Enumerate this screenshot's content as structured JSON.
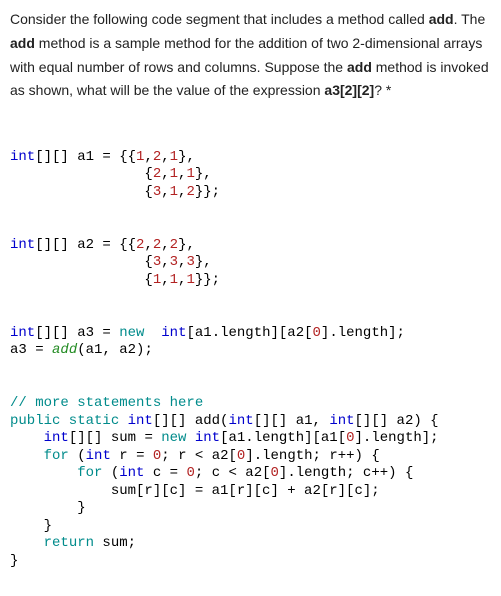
{
  "question": {
    "p1_a": "Consider the following code segment that includes a method called ",
    "add1": "add",
    "p1_b": ". The ",
    "add2": "add",
    "p1_c": " method is a sample method for the addition of two 2-dimensional arrays with equal number of rows and columns. Suppose the ",
    "add3": "add",
    "p1_d": " method is invoked as shown, what will be the value of the expression ",
    "expr": "a3[2][2]",
    "p1_e": "? *"
  },
  "code": {
    "a1_l1_a": "int",
    "a1_l1_b": "[][] a1 = {{",
    "a1_l1_c": "1",
    "a1_l1_d": ",",
    "a1_l1_e": "2",
    "a1_l1_f": ",",
    "a1_l1_g": "1",
    "a1_l1_h": "},",
    "a1_l2_a": "                {",
    "a1_l2_b": "2",
    "a1_l2_c": ",",
    "a1_l2_d": "1",
    "a1_l2_e": ",",
    "a1_l2_f": "1",
    "a1_l2_g": "},",
    "a1_l3_a": "                {",
    "a1_l3_b": "3",
    "a1_l3_c": ",",
    "a1_l3_d": "1",
    "a1_l3_e": ",",
    "a1_l3_f": "2",
    "a1_l3_g": "}};",
    "a2_l1_a": "int",
    "a2_l1_b": "[][] a2 = {{",
    "a2_l1_c": "2",
    "a2_l1_d": ",",
    "a2_l1_e": "2",
    "a2_l1_f": ",",
    "a2_l1_g": "2",
    "a2_l1_h": "},",
    "a2_l2_a": "                {",
    "a2_l2_b": "3",
    "a2_l2_c": ",",
    "a2_l2_d": "3",
    "a2_l2_e": ",",
    "a2_l2_f": "3",
    "a2_l2_g": "},",
    "a2_l3_a": "                {",
    "a2_l3_b": "1",
    "a2_l3_c": ",",
    "a2_l3_d": "1",
    "a2_l3_e": ",",
    "a2_l3_f": "1",
    "a2_l3_g": "}};",
    "a3_l1_a": "int",
    "a3_l1_b": "[][] a3 = ",
    "a3_l1_c": "new",
    "a3_l1_d": "  ",
    "a3_l1_e": "int",
    "a3_l1_f": "[a1.length][a2[",
    "a3_l1_g": "0",
    "a3_l1_h": "].length];",
    "a3_l2_a": "a3 = ",
    "a3_l2_b": "add",
    "a3_l2_c": "(a1, a2);",
    "cmt": "// more statements here",
    "m1_a": "public static ",
    "m1_b": "int",
    "m1_c": "[][] add(",
    "m1_d": "int",
    "m1_e": "[][] a1, ",
    "m1_f": "int",
    "m1_g": "[][] a2) {",
    "m2_a": "    ",
    "m2_b": "int",
    "m2_c": "[][] sum = ",
    "m2_d": "new",
    "m2_e": " ",
    "m2_f": "int",
    "m2_g": "[a1.length][a1[",
    "m2_h": "0",
    "m2_i": "].length];",
    "m3_a": "    ",
    "m3_b": "for",
    "m3_c": " (",
    "m3_d": "int",
    "m3_e": " r = ",
    "m3_f": "0",
    "m3_g": "; r < a2[",
    "m3_h": "0",
    "m3_i": "].length; r++) {",
    "m4_a": "        ",
    "m4_b": "for",
    "m4_c": " (",
    "m4_d": "int",
    "m4_e": " c = ",
    "m4_f": "0",
    "m4_g": "; c < a2[",
    "m4_h": "0",
    "m4_i": "].length; c++) {",
    "m5": "            sum[r][c] = a1[r][c] + a2[r][c];",
    "m6": "        }",
    "m7": "    }",
    "m8_a": "    ",
    "m8_b": "return",
    "m8_c": " sum;",
    "m9": "}"
  }
}
